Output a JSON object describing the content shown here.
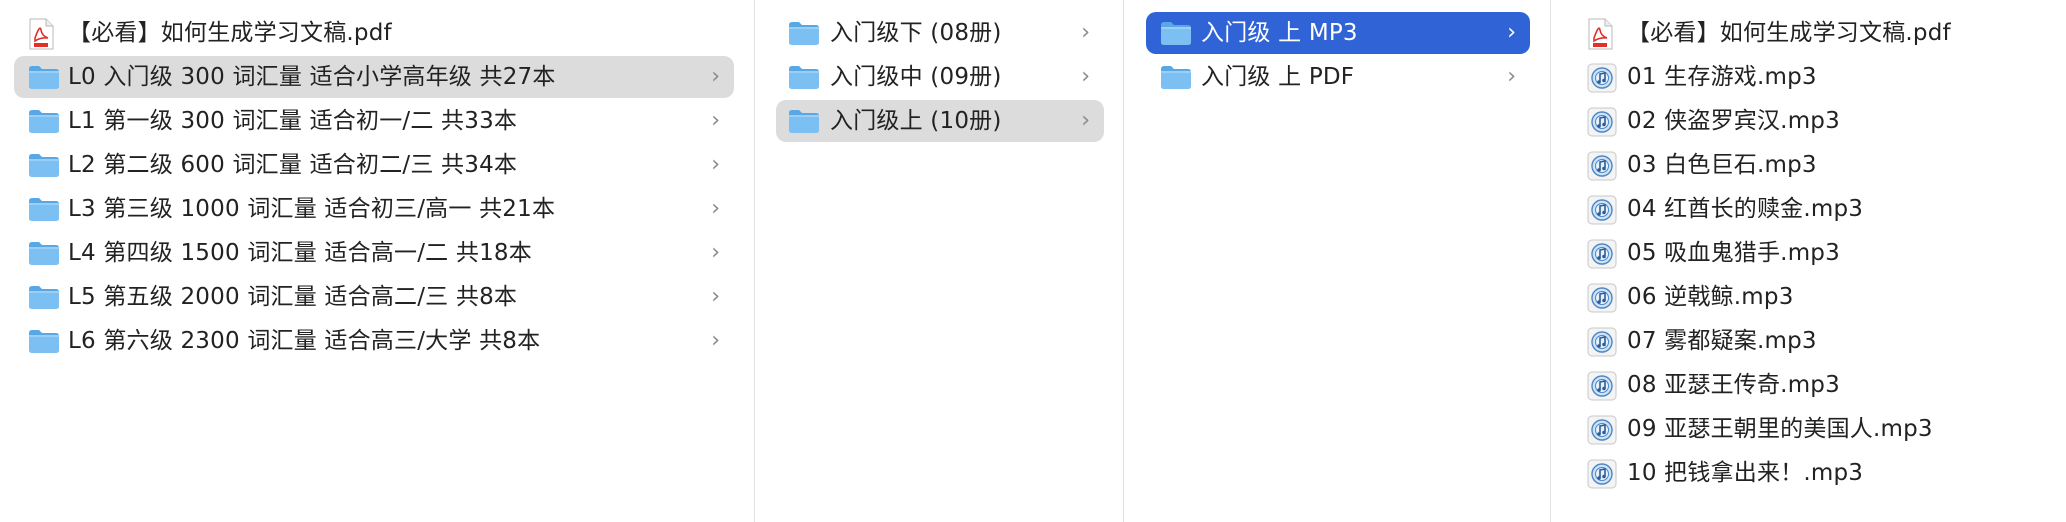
{
  "colors": {
    "selection_blue": "#2f63d6",
    "selection_gray": "#dcdcdc",
    "folder_blue": "#6fb6f0",
    "pdf_red": "#e0302b",
    "chevron_gray": "#8a8a8a"
  },
  "columns": [
    {
      "items": [
        {
          "icon": "pdf-icon",
          "label": "【必看】如何生成学习文稿.pdf",
          "has_children": false,
          "state": "normal"
        },
        {
          "icon": "folder-icon",
          "label": "L0 入门级 300 词汇量 适合小学高年级 共27本",
          "has_children": true,
          "state": "path-selected"
        },
        {
          "icon": "folder-icon",
          "label": "L1 第一级 300 词汇量 适合初一/二 共33本",
          "has_children": true,
          "state": "normal"
        },
        {
          "icon": "folder-icon",
          "label": "L2 第二级 600 词汇量 适合初二/三 共34本",
          "has_children": true,
          "state": "normal"
        },
        {
          "icon": "folder-icon",
          "label": "L3 第三级 1000 词汇量 适合初三/高一 共21本",
          "has_children": true,
          "state": "normal"
        },
        {
          "icon": "folder-icon",
          "label": "L4 第四级 1500 词汇量 适合高一/二 共18本",
          "has_children": true,
          "state": "normal"
        },
        {
          "icon": "folder-icon",
          "label": "L5 第五级 2000 词汇量 适合高二/三 共8本",
          "has_children": true,
          "state": "normal"
        },
        {
          "icon": "folder-icon",
          "label": "L6 第六级 2300 词汇量 适合高三/大学 共8本",
          "has_children": true,
          "state": "normal"
        }
      ]
    },
    {
      "items": [
        {
          "icon": "folder-icon",
          "label": "入门级下 (08册)",
          "has_children": true,
          "state": "normal"
        },
        {
          "icon": "folder-icon",
          "label": "入门级中 (09册)",
          "has_children": true,
          "state": "normal"
        },
        {
          "icon": "folder-icon",
          "label": "入门级上 (10册)",
          "has_children": true,
          "state": "path-selected"
        }
      ]
    },
    {
      "items": [
        {
          "icon": "folder-icon",
          "label": "入门级 上 MP3",
          "has_children": true,
          "state": "active-selected"
        },
        {
          "icon": "folder-icon",
          "label": "入门级 上 PDF",
          "has_children": true,
          "state": "normal"
        }
      ]
    },
    {
      "items": [
        {
          "icon": "pdf-icon",
          "label": "【必看】如何生成学习文稿.pdf",
          "has_children": false,
          "state": "normal"
        },
        {
          "icon": "mp3-icon",
          "label": "01 生存游戏.mp3",
          "has_children": false,
          "state": "normal"
        },
        {
          "icon": "mp3-icon",
          "label": "02 侠盗罗宾汉.mp3",
          "has_children": false,
          "state": "normal"
        },
        {
          "icon": "mp3-icon",
          "label": "03 白色巨石.mp3",
          "has_children": false,
          "state": "normal"
        },
        {
          "icon": "mp3-icon",
          "label": "04 红酋长的赎金.mp3",
          "has_children": false,
          "state": "normal"
        },
        {
          "icon": "mp3-icon",
          "label": "05 吸血鬼猎手.mp3",
          "has_children": false,
          "state": "normal"
        },
        {
          "icon": "mp3-icon",
          "label": "06 逆戟鲸.mp3",
          "has_children": false,
          "state": "normal"
        },
        {
          "icon": "mp3-icon",
          "label": "07 雾都疑案.mp3",
          "has_children": false,
          "state": "normal"
        },
        {
          "icon": "mp3-icon",
          "label": "08 亚瑟王传奇.mp3",
          "has_children": false,
          "state": "normal"
        },
        {
          "icon": "mp3-icon",
          "label": "09 亚瑟王朝里的美国人.mp3",
          "has_children": false,
          "state": "normal"
        },
        {
          "icon": "mp3-icon",
          "label": "10 把钱拿出来！.mp3",
          "has_children": false,
          "state": "normal"
        }
      ]
    }
  ]
}
